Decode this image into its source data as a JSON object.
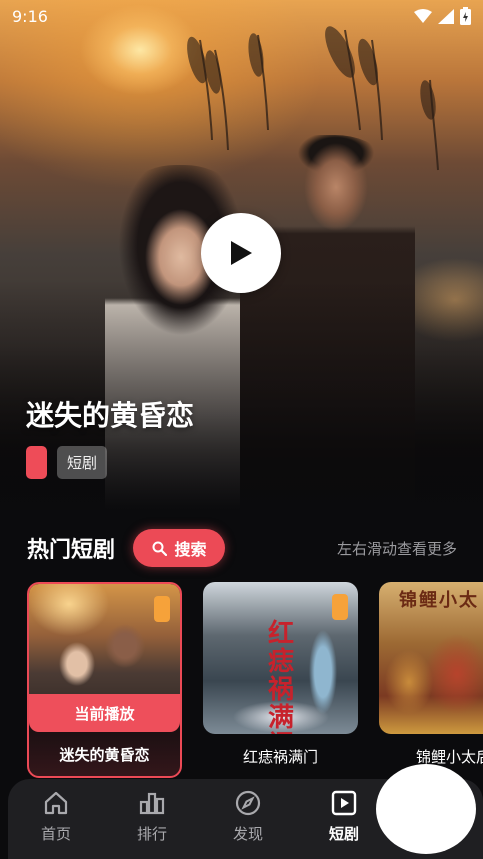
{
  "status_bar": {
    "time": "9:16"
  },
  "hero": {
    "title": "迷失的黄昏恋",
    "tag": "短剧",
    "poster_caption": "迷失的黄昏恋"
  },
  "section": {
    "title": "热门短剧",
    "search_label": "搜索",
    "swipe_hint": "左右滑动查看更多"
  },
  "cards": [
    {
      "name": "迷失的黄昏恋",
      "now_playing": "当前播放",
      "active": true
    },
    {
      "name": "红痣祸满门",
      "poster_text": "红痣祸满门",
      "active": false
    },
    {
      "name": "锦鲤小太后",
      "poster_text": "锦鲤小太",
      "active": false
    }
  ],
  "nav": {
    "items": [
      {
        "label": "首页",
        "icon": "home-icon"
      },
      {
        "label": "排行",
        "icon": "ranking-icon"
      },
      {
        "label": "发现",
        "icon": "compass-icon"
      },
      {
        "label": "短剧",
        "icon": "play-square-icon",
        "active": true
      }
    ]
  },
  "colors": {
    "accent": "#ec4a56",
    "badge": "#f6a23a",
    "background": "#0b0b0d",
    "nav_bg": "#1f1f22"
  }
}
